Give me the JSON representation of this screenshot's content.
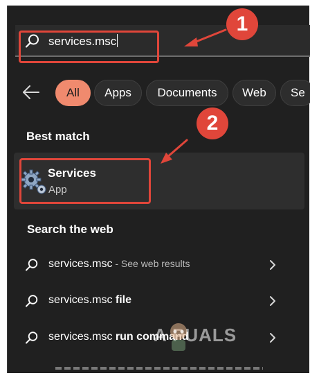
{
  "search": {
    "query": "services.msc"
  },
  "filters": [
    "All",
    "Apps",
    "Documents",
    "Web",
    "Se"
  ],
  "best_match": {
    "heading": "Best match",
    "title": "Services",
    "subtitle": "App"
  },
  "web": {
    "heading": "Search the web",
    "results": [
      {
        "query": "services.msc",
        "suffix": " - See web results"
      },
      {
        "query": "services.msc",
        "suffix": " file"
      },
      {
        "query": "services.msc",
        "suffix": " run command"
      }
    ]
  },
  "annotations": {
    "step1": "1",
    "step2": "2"
  },
  "watermark": "A  PUALS",
  "colors": {
    "accent": "#f08a6e",
    "highlight": "#e0463a",
    "panel": "#202020"
  }
}
